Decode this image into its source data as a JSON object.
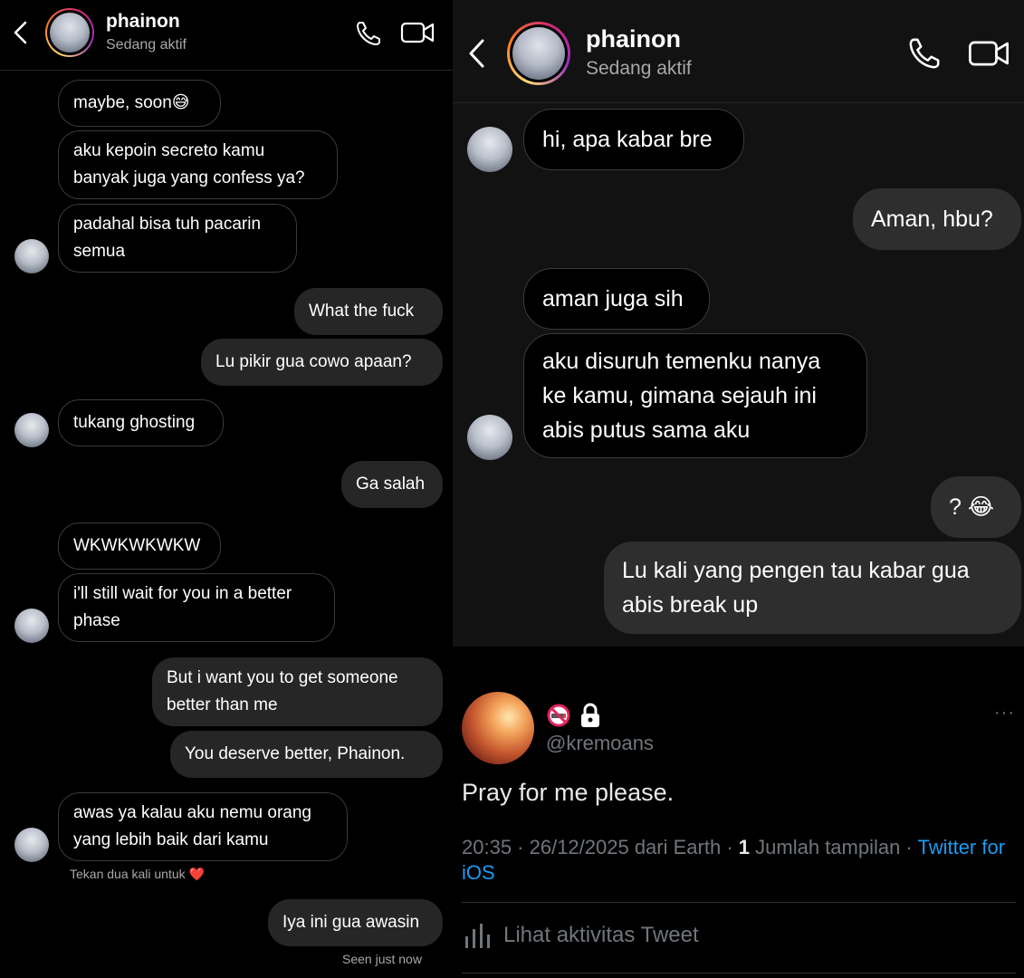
{
  "left": {
    "header": {
      "name": "phainon",
      "status": "Sedang aktif"
    },
    "messages": {
      "m1": "maybe, soon😅",
      "m2a": "aku kepoin secreto kamu",
      "m2b": "banyak juga yang confess ya?",
      "m3a": "padahal bisa tuh pacarin",
      "m3b": "semua",
      "m4": "What the fuck",
      "m5": "Lu pikir gua cowo apaan?",
      "m6": "tukang ghosting",
      "m7": "Ga salah",
      "m8": "WKWKWKWKW",
      "m9a": "i'll still wait for you in a better",
      "m9b": "phase",
      "m10a": "But i want you to get someone",
      "m10b": "better than me",
      "m11": "You deserve better, Phainon.",
      "m12a": "awas ya kalau aku nemu orang",
      "m12b": "yang lebih baik dari kamu",
      "m13": "Iya ini gua awasin"
    },
    "hint": "Tekan dua kali untuk ❤️",
    "seen": "Seen just now"
  },
  "right": {
    "header": {
      "name": "phainon",
      "status": "Sedang aktif"
    },
    "messages": {
      "r1": "hi, apa kabar bre",
      "r2": "Aman, hbu?",
      "r3": "aman juga sih",
      "r4a": "aku disuruh temenku nanya",
      "r4b": "ke kamu, gimana sejauh ini",
      "r4c": "abis putus sama aku",
      "r5": "? 😂",
      "r6a": "Lu kali yang pengen tau kabar gua",
      "r6b": "abis break up"
    }
  },
  "tweet": {
    "badges": [
      "no-smoking-icon",
      "lock-icon"
    ],
    "handle": "@kremoans",
    "more": "···",
    "text": "Pray for me please.",
    "meta_time": "20:35 · 26/12/2025 dari Earth · ",
    "meta_count": "1",
    "meta_views": " Jumlah tampilan · ",
    "meta_source": "Twitter for iOS",
    "activity": "Lihat aktivitas Tweet"
  }
}
